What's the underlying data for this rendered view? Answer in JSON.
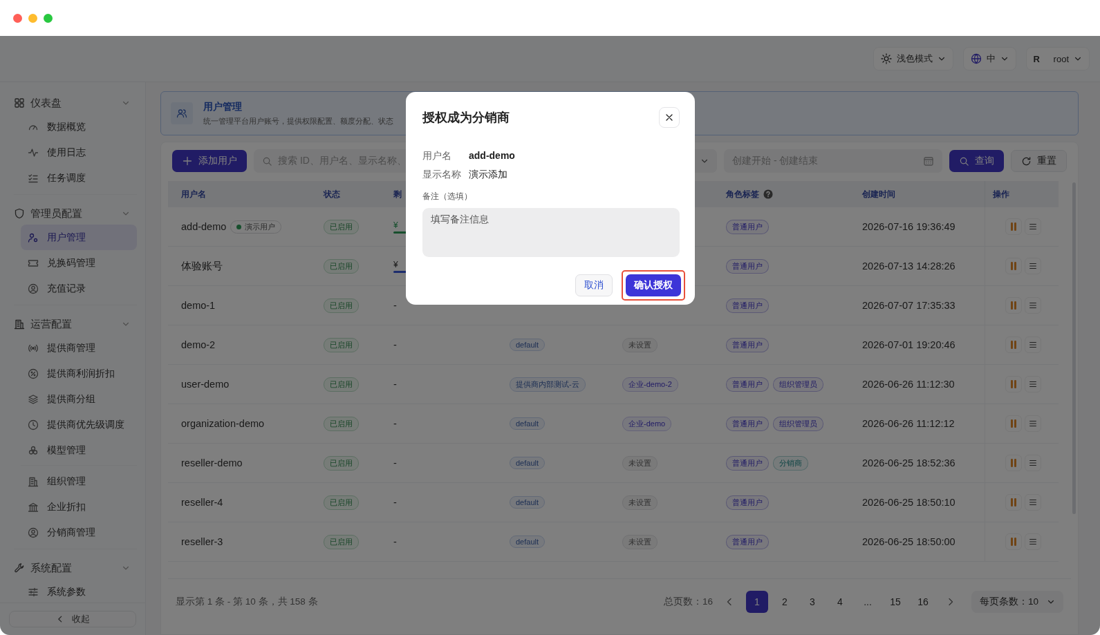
{
  "window": {
    "traffic_lights": [
      {
        "color": "#ff5f57"
      },
      {
        "color": "#febc2e"
      },
      {
        "color": "#28c840"
      }
    ]
  },
  "header": {
    "theme": "浅色模式",
    "language": "中",
    "user": {
      "avatar": "R",
      "name": "root"
    }
  },
  "sidebar": {
    "groups": [
      {
        "title": "仪表盘",
        "expanded": true,
        "sections": [
          {
            "items": [
              {
                "label": "数据概览",
                "selected": false
              },
              {
                "label": "使用日志",
                "selected": false
              },
              {
                "label": "任务调度",
                "selected": false
              }
            ]
          }
        ]
      },
      {
        "title": "管理员配置",
        "expanded": true,
        "sections": [
          {
            "items": [
              {
                "label": "用户管理",
                "selected": true
              },
              {
                "label": "兑换码管理",
                "selected": false
              },
              {
                "label": "充值记录",
                "selected": false
              }
            ]
          }
        ]
      },
      {
        "title": "运营配置",
        "expanded": true,
        "sections": [
          {
            "items": [
              {
                "label": "提供商管理",
                "selected": false
              },
              {
                "label": "提供商利润折扣",
                "selected": false
              },
              {
                "label": "提供商分组",
                "selected": false
              },
              {
                "label": "提供商优先级调度",
                "selected": false
              },
              {
                "label": "模型管理",
                "selected": false
              }
            ]
          },
          {
            "items": [
              {
                "label": "组织管理",
                "selected": false
              },
              {
                "label": "企业折扣",
                "selected": false
              },
              {
                "label": "分销商管理",
                "selected": false
              }
            ]
          }
        ]
      },
      {
        "title": "系统配置",
        "expanded": true,
        "sections": [
          {
            "items": [
              {
                "label": "系统参数",
                "selected": false
              }
            ]
          }
        ]
      }
    ],
    "collapse": "收起"
  },
  "banner": {
    "title": "用户管理",
    "description": "统一管理平台用户账号，提供权限配置、额度分配、状态"
  },
  "toolbar": {
    "add_button": "添加用户",
    "search": {
      "placeholder": "搜索 ID、用户名、显示名称、"
    },
    "date_range": {
      "placeholder": "创建开始 - 创建结束"
    },
    "query_button": "查询",
    "reset_button": "重置"
  },
  "table": {
    "header": {
      "username": "用户名",
      "status": "状态",
      "column_3": "剩",
      "roles": "角色标签",
      "created": "创建时间",
      "actions": "操作"
    },
    "rows": [
      {
        "username": "add-demo",
        "badge": {
          "label": "演示用户"
        },
        "status": "已启用",
        "column_3": {
          "kind": "green",
          "text": "¥"
        },
        "roles": [
          {
            "label": "普通用户",
            "kind": "standard"
          }
        ],
        "created": "2026-07-16 19:36:49"
      },
      {
        "username": "体验账号",
        "status": "已启用",
        "column_3": {
          "kind": "blue",
          "text": "¥"
        },
        "roles": [
          {
            "label": "普通用户",
            "kind": "standard"
          }
        ],
        "created": "2026-07-13 14:28:26"
      },
      {
        "username": "demo-1",
        "status": "已启用",
        "column_3": {
          "kind": "dash",
          "text": "-"
        },
        "roles": [
          {
            "label": "普通用户",
            "kind": "standard"
          }
        ],
        "created": "2026-07-07 17:35:33"
      },
      {
        "username": "demo-2",
        "status": "已启用",
        "column_3": {
          "kind": "dash",
          "text": "-"
        },
        "column_4": "default",
        "column_5": {
          "label": "未设置",
          "kind": "unset"
        },
        "roles": [
          {
            "label": "普通用户",
            "kind": "standard"
          }
        ],
        "created": "2026-07-01 19:20:46"
      },
      {
        "username": "user-demo",
        "status": "已启用",
        "column_3": {
          "kind": "dash",
          "text": "-"
        },
        "column_4": "提供商内部测试-云",
        "column_5": {
          "label": "企业-demo-2",
          "kind": "org"
        },
        "roles": [
          {
            "label": "普通用户",
            "kind": "standard"
          },
          {
            "label": "组织管理员",
            "kind": "standard"
          }
        ],
        "created": "2026-06-26 11:12:30"
      },
      {
        "username": "organization-demo",
        "status": "已启用",
        "column_3": {
          "kind": "dash",
          "text": "-"
        },
        "column_4": "default",
        "column_5": {
          "label": "企业-demo",
          "kind": "org"
        },
        "roles": [
          {
            "label": "普通用户",
            "kind": "standard"
          },
          {
            "label": "组织管理员",
            "kind": "standard"
          }
        ],
        "created": "2026-06-26 11:12:12"
      },
      {
        "username": "reseller-demo",
        "status": "已启用",
        "column_3": {
          "kind": "dash",
          "text": "-"
        },
        "column_4": "default",
        "column_5": {
          "label": "未设置",
          "kind": "unset"
        },
        "roles": [
          {
            "label": "普通用户",
            "kind": "standard"
          },
          {
            "label": "分销商",
            "kind": "reseller"
          }
        ],
        "created": "2026-06-25 18:52:36"
      },
      {
        "username": "reseller-4",
        "status": "已启用",
        "column_3": {
          "kind": "dash",
          "text": "-"
        },
        "column_4": "default",
        "column_5": {
          "label": "未设置",
          "kind": "unset"
        },
        "roles": [
          {
            "label": "普通用户",
            "kind": "standard"
          }
        ],
        "created": "2026-06-25 18:50:10"
      },
      {
        "username": "reseller-3",
        "status": "已启用",
        "column_3": {
          "kind": "dash",
          "text": "-"
        },
        "column_4": "default",
        "column_5": {
          "label": "未设置",
          "kind": "unset"
        },
        "roles": [
          {
            "label": "普通用户",
            "kind": "standard"
          }
        ],
        "created": "2026-06-25 18:50:00"
      }
    ]
  },
  "pagination": {
    "summary": "显示第 1 条 - 第 10 条，共 158 条",
    "total_pages": "总页数：16",
    "pages": [
      {
        "label": "1",
        "selected": true
      },
      {
        "label": "2",
        "selected": false
      },
      {
        "label": "3",
        "selected": false
      },
      {
        "label": "4",
        "selected": false
      },
      {
        "label": "...",
        "selected": false
      },
      {
        "label": "15",
        "selected": false
      },
      {
        "label": "16",
        "selected": false
      }
    ],
    "page_size": "每页条数：10"
  },
  "modal": {
    "title": "授权成为分销商",
    "fields": [
      {
        "label": "用户名",
        "value": "add-demo",
        "bold": true
      },
      {
        "label": "显示名称",
        "value": "演示添加",
        "bold": false
      }
    ],
    "note": {
      "label": "备注（选填）",
      "placeholder": "填写备注信息"
    },
    "cancel": "取消",
    "confirm": "确认授权",
    "confirm_highlighted": true
  }
}
